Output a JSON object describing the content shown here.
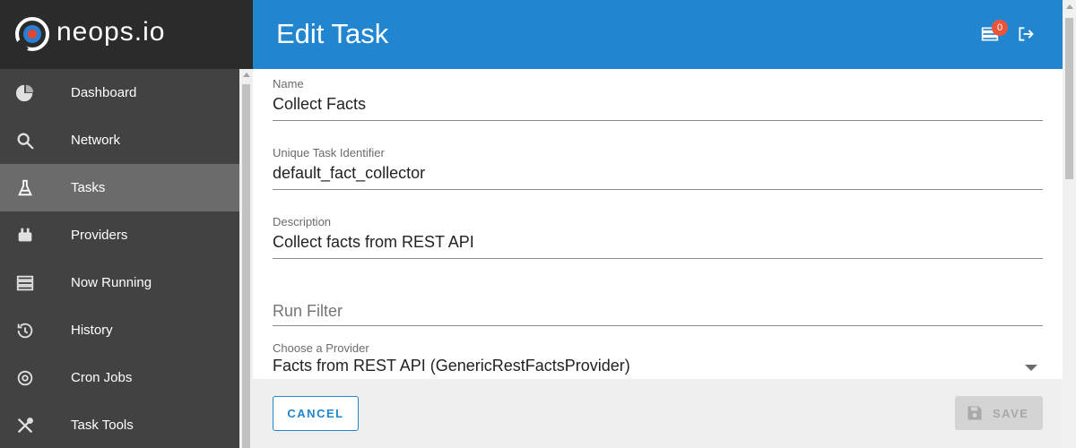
{
  "brand": {
    "name": "neops.io"
  },
  "sidebar": {
    "items": [
      {
        "label": "Dashboard",
        "icon": "pie-chart-icon",
        "active": false
      },
      {
        "label": "Network",
        "icon": "search-icon",
        "active": false
      },
      {
        "label": "Tasks",
        "icon": "flask-icon",
        "active": true
      },
      {
        "label": "Providers",
        "icon": "plug-icon",
        "active": false
      },
      {
        "label": "Now Running",
        "icon": "queue-icon",
        "active": false
      },
      {
        "label": "History",
        "icon": "history-icon",
        "active": false
      },
      {
        "label": "Cron Jobs",
        "icon": "cron-icon",
        "active": false
      },
      {
        "label": "Task Tools",
        "icon": "tools-icon",
        "active": false
      }
    ]
  },
  "header": {
    "title": "Edit Task",
    "queue_badge": "0"
  },
  "form": {
    "name": {
      "label": "Name",
      "value": "Collect Facts"
    },
    "identifier": {
      "label": "Unique Task Identifier",
      "value": "default_fact_collector"
    },
    "description": {
      "label": "Description",
      "value": "Collect facts from REST API"
    },
    "run_filter": {
      "placeholder": "Run Filter",
      "value": ""
    },
    "provider": {
      "label": "Choose a Provider",
      "value": "Facts from REST API (GenericRestFactsProvider)"
    }
  },
  "footer": {
    "cancel_label": "CANCEL",
    "save_label": "SAVE",
    "save_enabled": false
  },
  "colors": {
    "accent": "#2185d0",
    "sidebar_bg": "#424242",
    "sidebar_active": "#6b6b6b",
    "badge": "#e8553b"
  }
}
